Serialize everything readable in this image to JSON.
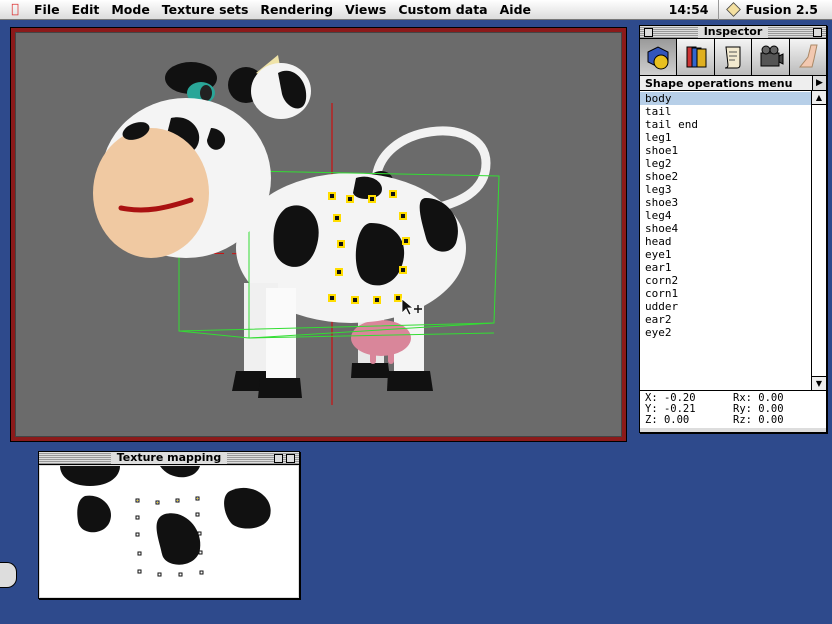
{
  "menubar": {
    "apple_icon": "apple-icon",
    "items": [
      "File",
      "Edit",
      "Mode",
      "Texture sets",
      "Rendering",
      "Views",
      "Custom data",
      "Aide"
    ],
    "clock": "14:54",
    "app_name": "Fusion 2.5"
  },
  "viewport": {
    "frame_color": "#8b1a1a",
    "background_color": "#6b6b6b"
  },
  "inspector": {
    "title": "Inspector",
    "tools": [
      "shapes-tool-icon",
      "textures-tool-icon",
      "script-scroll-icon",
      "camera-tool-icon",
      "bones-leg-icon"
    ],
    "menu_title": "Shape operations menu",
    "shapes": [
      "body",
      "tail",
      "tail end",
      "leg1",
      "shoe1",
      "leg2",
      "shoe2",
      "leg3",
      "shoe3",
      "leg4",
      "shoe4",
      "head",
      "eye1",
      "ear1",
      "corn2",
      "corn1",
      "udder",
      "ear2",
      "eye2"
    ],
    "selected_shape": "body",
    "coords": {
      "x": "X: -0.20",
      "rx": "Rx: 0.00",
      "y": "Y: -0.21",
      "ry": "Ry: 0.00",
      "z": "Z: 0.00",
      "rz": "Rz: 0.00"
    }
  },
  "texture_window": {
    "title": "Texture mapping"
  },
  "colors": {
    "desktop": "#2e4a8c",
    "selection": "#b7cfe8",
    "bounding_box": "#33dd33",
    "axis": "#cc1111",
    "control_point": "#ffdd00"
  }
}
